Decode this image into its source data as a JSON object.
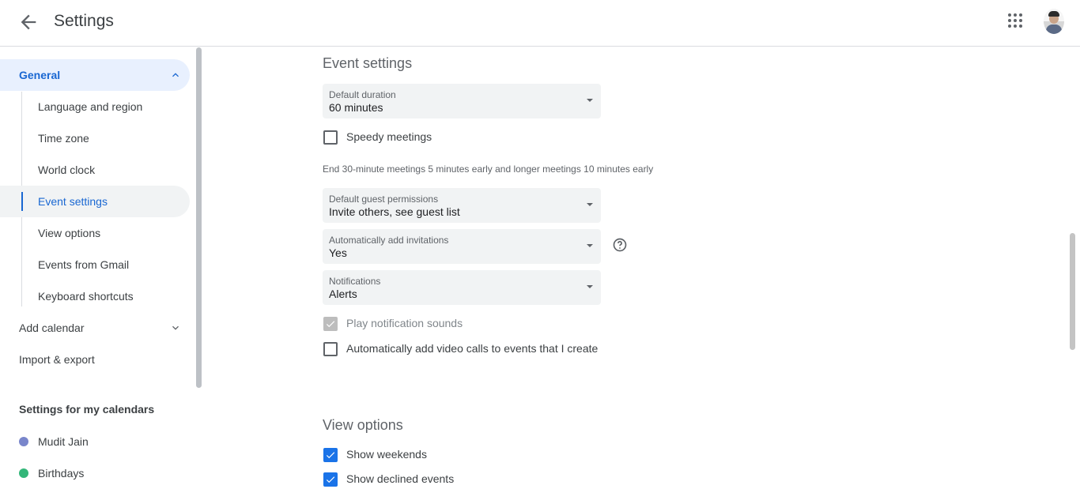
{
  "header": {
    "title": "Settings",
    "back_icon": "arrow-back-icon",
    "apps_icon": "apps-grid-icon",
    "avatar_icon": "user-avatar"
  },
  "sidebar": {
    "general": "General",
    "sub_items": [
      "Language and region",
      "Time zone",
      "World clock",
      "Event settings",
      "View options",
      "Events from Gmail",
      "Keyboard shortcuts"
    ],
    "add_calendar": "Add calendar",
    "import_export": "Import & export",
    "my_calendars_label": "Settings for my calendars",
    "calendars": [
      {
        "name": "Mudit Jain",
        "color": "#7986cb"
      },
      {
        "name": "Birthdays",
        "color": "#33b679"
      }
    ]
  },
  "event_settings": {
    "title": "Event settings",
    "default_duration": {
      "label": "Default duration",
      "value": "60 minutes"
    },
    "speedy_meetings": {
      "label": "Speedy meetings",
      "checked": false
    },
    "speedy_hint": "End 30-minute meetings 5 minutes early and longer meetings 10 minutes early",
    "guest_permissions": {
      "label": "Default guest permissions",
      "value": "Invite others, see guest list"
    },
    "add_invitations": {
      "label": "Automatically add invitations",
      "value": "Yes"
    },
    "notifications": {
      "label": "Notifications",
      "value": "Alerts"
    },
    "play_sounds": {
      "label": "Play notification sounds",
      "checked": true,
      "disabled": true
    },
    "video_calls": {
      "label": "Automatically add video calls to events that I create",
      "checked": false
    }
  },
  "view_options": {
    "title": "View options",
    "show_weekends": {
      "label": "Show weekends",
      "checked": true
    },
    "show_declined": {
      "label": "Show declined events",
      "checked": true
    }
  },
  "colors": {
    "accent": "#1a73e8",
    "active_text": "#1967d2",
    "active_bg": "#e8f0fe"
  }
}
